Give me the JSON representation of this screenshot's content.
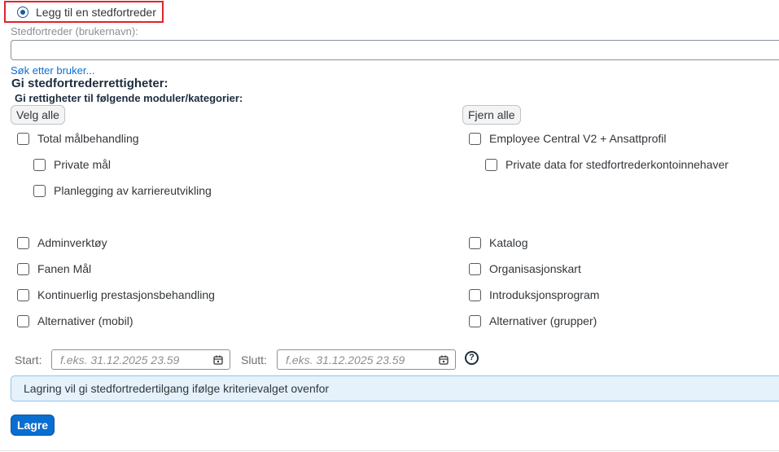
{
  "radio": {
    "label": "Legg til en stedfortreder",
    "selected": true
  },
  "delegate_field": {
    "label": "Stedfortreder (brukernavn):",
    "value": "",
    "placeholder": ""
  },
  "search_link": "Søk etter bruker...",
  "section_title": "Gi stedfortrederrettigheter:",
  "sub_title": "Gi rettigheter til følgende moduler/kategorier:",
  "buttons": {
    "select_all": "Velg alle",
    "remove_all": "Fjern alle",
    "save": "Lagre"
  },
  "left_column": {
    "group": "Total målbehandling",
    "children": [
      "Private mål",
      "Planlegging av karriereutvikling"
    ],
    "items": [
      "Adminverktøy",
      "Fanen Mål",
      "Kontinuerlig prestasjonsbehandling",
      "Alternativer (mobil)"
    ]
  },
  "right_column": {
    "group": "Employee Central V2 + Ansattprofil",
    "children": [
      "Private data for stedfortrederkontoinnehaver"
    ],
    "items": [
      "Katalog",
      "Organisasjonskart",
      "Introduksjonsprogram",
      "Alternativer (grupper)"
    ]
  },
  "dates": {
    "start_label": "Start:",
    "start_placeholder": "f.eks. 31.12.2025 23.59",
    "end_label": "Slutt:",
    "end_placeholder": "f.eks. 31.12.2025 23.59"
  },
  "info_message": "Lagring vil gi stedfortredertilgang ifølge kriterievalget ovenfor",
  "icons": {
    "calendar": "calendar-icon",
    "help": "help-icon"
  },
  "colors": {
    "accent": "#0a6ed1",
    "highlight_border": "#e0242b",
    "info_bg": "#e5f2fc"
  }
}
